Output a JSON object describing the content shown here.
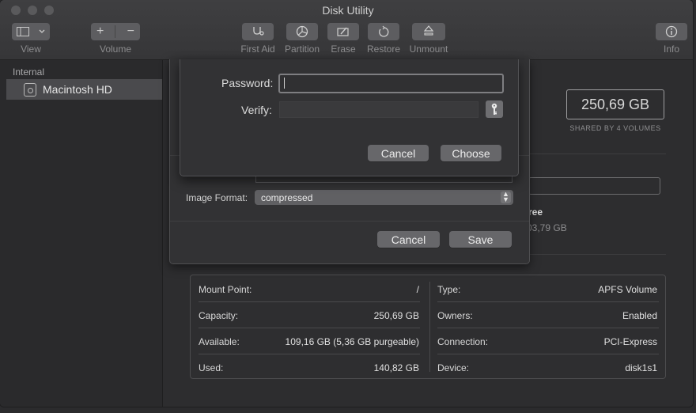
{
  "window": {
    "title": "Disk Utility"
  },
  "toolbar": {
    "view_label": "View",
    "volume_label": "Volume",
    "first_aid_label": "First Aid",
    "partition_label": "Partition",
    "erase_label": "Erase",
    "restore_label": "Restore",
    "unmount_label": "Unmount",
    "info_label": "Info",
    "add_glyph": "+",
    "remove_glyph": "−"
  },
  "sidebar": {
    "section": "Internal",
    "items": [
      {
        "label": "Macintosh HD",
        "icon": "hard-disk-icon",
        "selected": true
      }
    ]
  },
  "main": {
    "size": "250,69 GB",
    "shared_caption": "SHARED BY 4 VOLUMES",
    "free_label_partial": "ree",
    "free_value_partial": "03,79 GB"
  },
  "info": {
    "left": [
      {
        "label": "Mount Point:",
        "value": "/"
      },
      {
        "label": "Capacity:",
        "value": "250,69 GB"
      },
      {
        "label": "Available:",
        "value": "109,16 GB (5,36 GB purgeable)"
      },
      {
        "label": "Used:",
        "value": "140,82 GB"
      }
    ],
    "right": [
      {
        "label": "Type:",
        "value": "APFS Volume"
      },
      {
        "label": "Owners:",
        "value": "Enabled"
      },
      {
        "label": "Connection:",
        "value": "PCI-Express"
      },
      {
        "label": "Device:",
        "value": "disk1s1"
      }
    ]
  },
  "image_sheet": {
    "format_label": "Image Format:",
    "format_value": "compressed",
    "cancel_label": "Cancel",
    "save_label": "Save"
  },
  "password_sheet": {
    "password_label": "Password:",
    "password_value": "",
    "verify_label": "Verify:",
    "verify_value": "",
    "cancel_label": "Cancel",
    "choose_label": "Choose"
  }
}
